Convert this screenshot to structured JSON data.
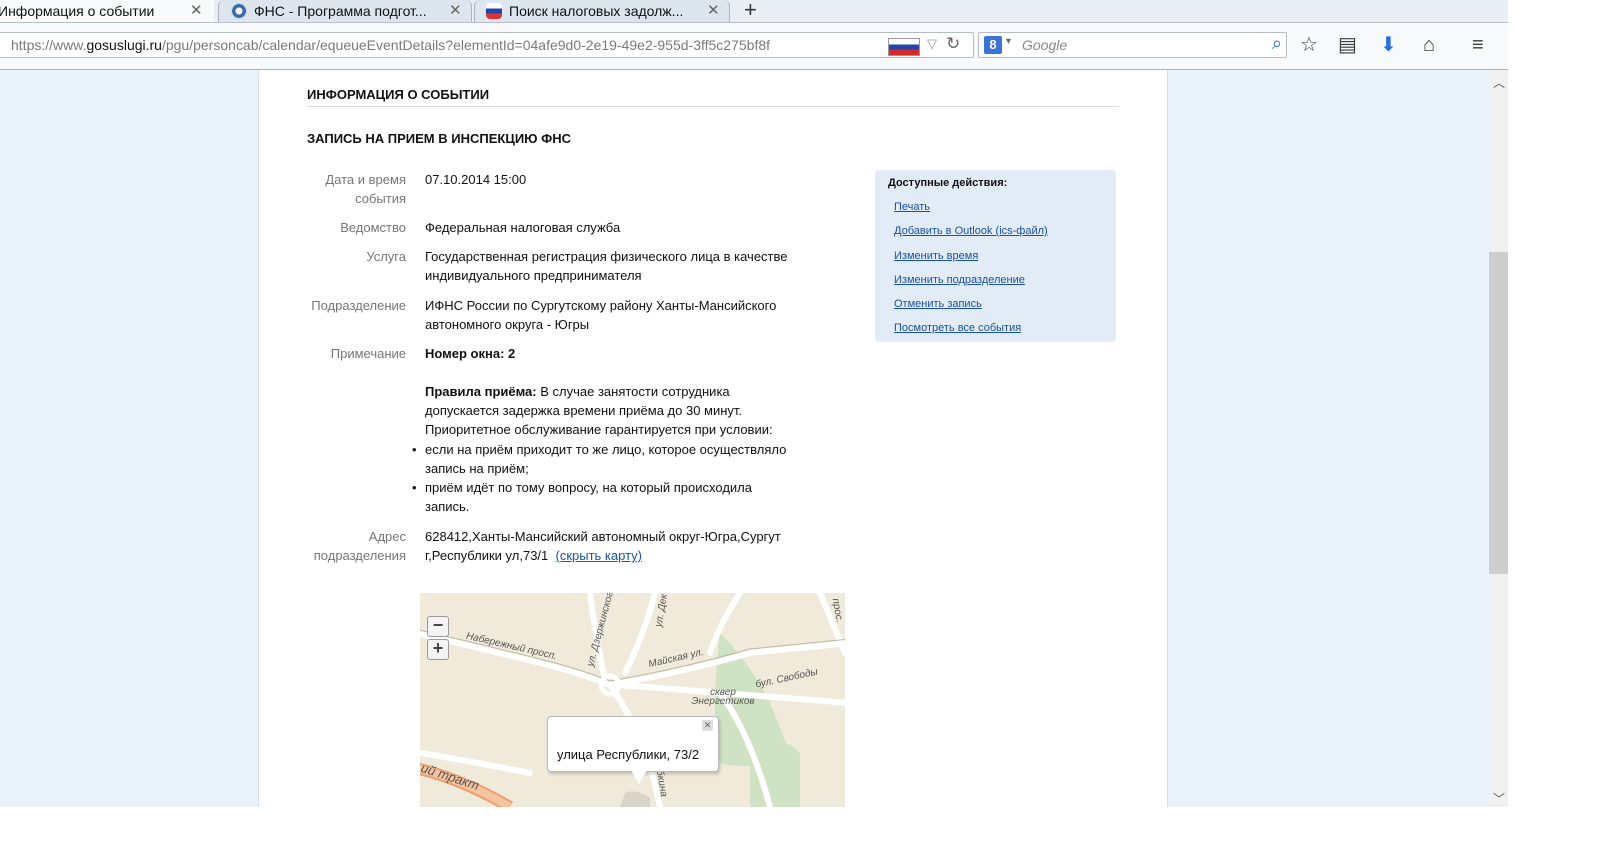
{
  "browser": {
    "tabs": [
      {
        "title": "Информация о событии",
        "close": "✕"
      },
      {
        "title": "ФНС - Программа подгот...",
        "close": "✕"
      },
      {
        "title": "Поиск налоговых задолж...",
        "close": "✕"
      }
    ],
    "new_tab": "+",
    "url_prefix": "https://www.",
    "url_domain": "gosuslugi.ru",
    "url_path": "/pgu/personcab/calendar/equeueEventDetails?elementId=04afe9d0-2e19-49e2-955d-3ff5c275bf8f",
    "search_placeholder": "Google",
    "search_engine_icon": "8",
    "icons": [
      "star-icon",
      "reading-list-icon",
      "download-icon",
      "home-icon",
      "menu-icon"
    ]
  },
  "page": {
    "section_title": "ИНФОРМАЦИЯ О СОБЫТИИ",
    "event_title": "ЗАПИСЬ НА ПРИЕМ В ИНСПЕКЦИЮ ФНС",
    "fields": {
      "datetime_label": "Дата и время события",
      "datetime_value": "07.10.2014 15:00",
      "agency_label": "Ведомство",
      "agency_value": "Федеральная налоговая служба",
      "service_label": "Услуга",
      "service_value": "Государственная регистрация физического лица в качестве индивидуального предпринимателя",
      "division_label": "Подразделение",
      "division_value": "ИФНС России по Сургутскому району Ханты-Мансийского автономного округа - Югры",
      "note_label": "Примечание",
      "note_window": "Номер окна: 2",
      "rules_bold": "Правила приёма:",
      "rules_text": " В случае занятости сотрудника допускается задержка времени приёма до 30 минут. Приоритетное обслуживание гарантируется при условии:",
      "rule_1": "если на приём приходит то же лицо, которое осуществляло запись на приём;",
      "rule_2": "приём идёт по тому вопросу, на который происходила запись.",
      "address_label": "Адрес подразделения",
      "address_value": "628412,Ханты-Мансийский автономный округ-Югра,Сургут г,Республики ул,73/1",
      "hide_map_link": "(скрыть карту)"
    },
    "actions": {
      "title": "Доступные действия:",
      "items": [
        "Печать",
        "Добавить в Outlook (ics-файл)",
        "Изменить время",
        "Изменить подразделение",
        "Отменить запись",
        "Посмотреть все события"
      ]
    },
    "map": {
      "zoom_out": "−",
      "zoom_in": "+",
      "labels": {
        "naberezhny": "Набережный просп.",
        "mayskaya": "Майская ул.",
        "svobody": "бул. Свободы",
        "skver": "сквер Энергетиков",
        "dzerzhinskogo": "ул. Дзержинского",
        "dek": "ул. Дек",
        "pros": "прос.",
        "trakt": "ий тракт",
        "gubkina": "губкина"
      },
      "popup_text": "улица Республики, 73/2",
      "popup_close": "✕"
    }
  }
}
